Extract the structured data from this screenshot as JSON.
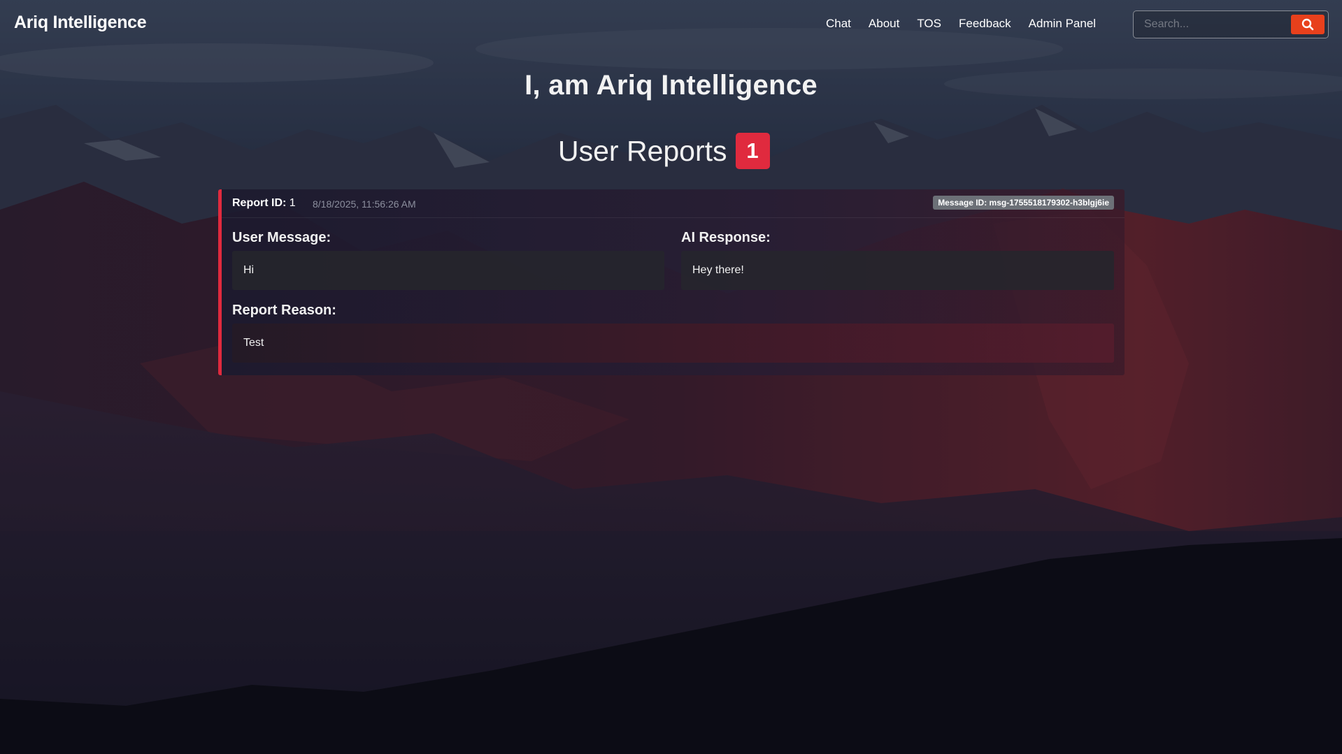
{
  "app": {
    "brand": "Ariq Intelligence"
  },
  "nav": {
    "links": [
      "Chat",
      "About",
      "TOS",
      "Feedback",
      "Admin Panel"
    ]
  },
  "search": {
    "placeholder": "Search...",
    "icon": "search-icon"
  },
  "hero": {
    "title": "I, am Ariq Intelligence"
  },
  "reports": {
    "heading": "User Reports",
    "count": "1",
    "items": [
      {
        "id_label": "Report ID:",
        "id": "1",
        "timestamp": "8/18/2025, 11:56:26 AM",
        "message_id": "Message ID: msg-1755518179302-h3blgj6ie",
        "user_message_label": "User Message:",
        "user_message": "Hi",
        "ai_response_label": "AI Response:",
        "ai_response": "Hey there!",
        "reason_label": "Report Reason:",
        "reason": "Test"
      }
    ]
  },
  "colors": {
    "accent_red": "#e02a3e",
    "search_button": "#e8401c",
    "badge_gray": "#6c7077"
  }
}
